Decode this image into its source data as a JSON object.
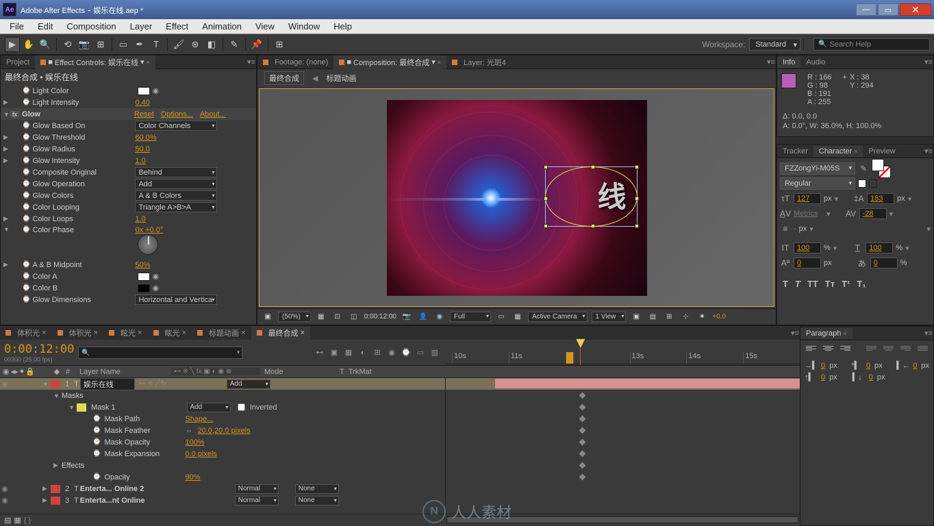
{
  "titlebar": {
    "app": "Adobe After Effects",
    "file": "娱乐在线.aep *"
  },
  "menu": [
    "File",
    "Edit",
    "Composition",
    "Layer",
    "Effect",
    "Animation",
    "View",
    "Window",
    "Help"
  ],
  "workspace": {
    "label": "Workspace:",
    "value": "Standard",
    "search": "Search Help"
  },
  "effectControls": {
    "tab_project": "Project",
    "tab_ec": "Effect Controls: 娱乐在线",
    "header": "最终合成 • 娱乐在线",
    "rows": {
      "lightColor": "Light Color",
      "lightIntensity": {
        "label": "Light Intensity",
        "val": "0.40"
      },
      "glow": {
        "label": "Glow",
        "reset": "Reset",
        "options": "Options...",
        "about": "About..."
      },
      "glowBasedOn": {
        "label": "Glow Based On",
        "val": "Color Channels"
      },
      "glowThreshold": {
        "label": "Glow Threshold",
        "val": "60.0%"
      },
      "glowRadius": {
        "label": "Glow Radius",
        "val": "50.0"
      },
      "glowIntensity": {
        "label": "Glow Intensity",
        "val": "1.0"
      },
      "compositeOriginal": {
        "label": "Composite Original",
        "val": "Behind"
      },
      "glowOperation": {
        "label": "Glow Operation",
        "val": "Add"
      },
      "glowColors": {
        "label": "Glow Colors",
        "val": "A & B Colors"
      },
      "colorLooping": {
        "label": "Color Looping",
        "val": "Triangle A>B>A"
      },
      "colorLoops": {
        "label": "Color Loops",
        "val": "1.0"
      },
      "colorPhase": {
        "label": "Color Phase",
        "val": "0x +0.0°"
      },
      "abMidpoint": {
        "label": "A & B Midpoint",
        "val": "50%"
      },
      "colorA": "Color A",
      "colorB": "Color B",
      "glowDimensions": {
        "label": "Glow Dimensions",
        "val": "Horizontal and Vertica"
      }
    }
  },
  "comp": {
    "tab_footage": "Footage: (none)",
    "tab_comp": "Composition: 最终合成",
    "tab_layer": "Layer: 光斑4",
    "bc_a": "最终合成",
    "bc_b": "标题动画",
    "text3d": "线",
    "footer": {
      "zoom": "(50%)",
      "time": "0:00:12:00",
      "res": "Full",
      "camera": "Active Camera",
      "view": "1 View",
      "exposure": "+0.0"
    }
  },
  "info": {
    "tab_info": "Info",
    "tab_audio": "Audio",
    "r": "R : 166",
    "g": "G : 98",
    "b": "B : 191",
    "a": "A : 255",
    "x": "X : 38",
    "y": "Y : 294",
    "delta": "Δ: 0.0, 0.0",
    "anchor": "A: 0.0°, W: 36.0%, H: 100.0%"
  },
  "rightTabs": {
    "tracker": "Tracker",
    "character": "Character",
    "preview": "Preview"
  },
  "char": {
    "font": "FZZongYi-M05S",
    "style": "Regular",
    "size": "127",
    "sizeUnit": "px",
    "leading": "183",
    "leadUnit": "px",
    "kerning": "Metrics",
    "tracking": "-28",
    "vscale": "100",
    "hscale": "100",
    "pct": "%",
    "baseline": "0",
    "tsume": "0",
    "px": "px",
    "dash": "-"
  },
  "timeline": {
    "tabs": [
      "体积光",
      "体积光",
      "眩光",
      "眩光",
      "标题动画",
      "最终合成"
    ],
    "timecode": "0:00:12:00",
    "frameInfo": "00300 (25.00 fps)",
    "ruler": [
      "10s",
      "11s",
      "",
      "13s",
      "14s",
      "15s"
    ],
    "colLayerName": "Layer Name",
    "colMode": "Mode",
    "colTrkMat": "TrkMat",
    "layer1": {
      "idx": "1",
      "name": "娱乐在线",
      "mode": "Add"
    },
    "masks": "Masks",
    "mask1": {
      "name": "Mask 1",
      "mode": "Add",
      "inverted": "Inverted"
    },
    "maskPath": {
      "label": "Mask Path",
      "val": "Shape..."
    },
    "maskFeather": {
      "label": "Mask Feather",
      "val": "20.0,20.0 pixels"
    },
    "maskOpacity": {
      "label": "Mask Opacity",
      "val": "100%"
    },
    "maskExpansion": {
      "label": "Mask Expansion",
      "val": "0.0 pixels"
    },
    "effects": "Effects",
    "opacity": {
      "label": "Opacity",
      "val": "90%"
    },
    "layer2": {
      "idx": "2",
      "name": "Enterta... Online 2",
      "mode": "Normal",
      "trk": "None"
    },
    "layer3": {
      "idx": "3",
      "name": "Enterta...nt Online",
      "mode": "Normal",
      "trk": "None"
    },
    "t": "T"
  },
  "paragraph": {
    "tab": "Paragraph",
    "indL": "0",
    "indR": "0",
    "indF": "0",
    "spB": "0",
    "spA": "0",
    "px": "px"
  },
  "watermark": {
    "icon": "N",
    "text": "人人素材"
  }
}
